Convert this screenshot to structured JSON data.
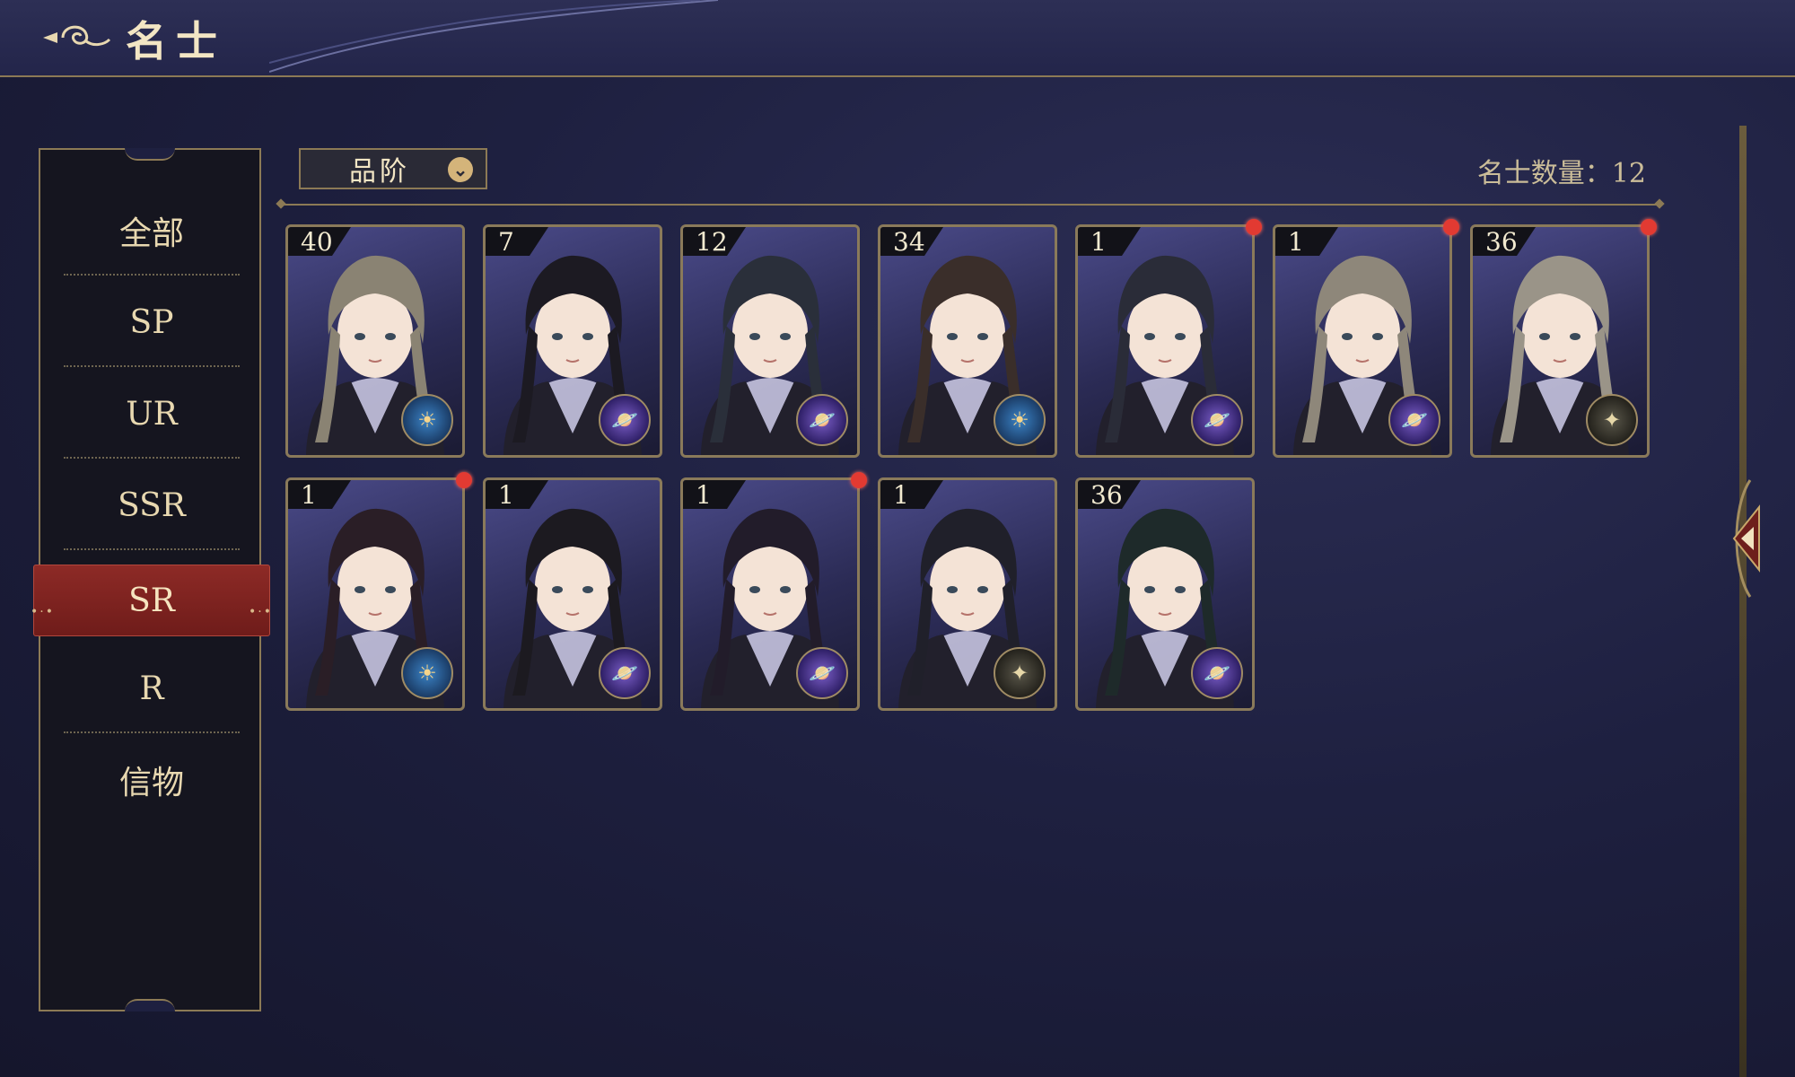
{
  "header": {
    "title": "名士"
  },
  "sidebar": {
    "items": [
      {
        "label": "全部"
      },
      {
        "label": "SP"
      },
      {
        "label": "UR"
      },
      {
        "label": "SSR"
      },
      {
        "label": "SR"
      },
      {
        "label": "R"
      },
      {
        "label": "信物"
      }
    ],
    "active_index": 4
  },
  "filter": {
    "label": "品阶"
  },
  "count_text": "名士数量：12",
  "cards": [
    {
      "level": "40",
      "badge": "blue",
      "new": false,
      "icon": "sun-emblem-icon"
    },
    {
      "level": "7",
      "badge": "purple",
      "new": false,
      "icon": "planet-emblem-icon"
    },
    {
      "level": "12",
      "badge": "purple",
      "new": false,
      "icon": "planet-emblem-icon"
    },
    {
      "level": "34",
      "badge": "blue",
      "new": false,
      "icon": "sun-emblem-icon"
    },
    {
      "level": "1",
      "badge": "purple",
      "new": true,
      "icon": "planet-emblem-icon"
    },
    {
      "level": "1",
      "badge": "purple",
      "new": true,
      "icon": "planet-emblem-icon"
    },
    {
      "level": "36",
      "badge": "dark",
      "new": true,
      "icon": "star-emblem-icon"
    },
    {
      "level": "1",
      "badge": "blue",
      "new": true,
      "icon": "sun-emblem-icon"
    },
    {
      "level": "1",
      "badge": "purple",
      "new": false,
      "icon": "planet-emblem-icon"
    },
    {
      "level": "1",
      "badge": "purple",
      "new": true,
      "icon": "planet-emblem-icon"
    },
    {
      "level": "1",
      "badge": "dark",
      "new": false,
      "icon": "star-emblem-icon"
    },
    {
      "level": "36",
      "badge": "purple",
      "new": false,
      "icon": "planet-emblem-icon"
    }
  ],
  "colors": {
    "gold": "#8c7a55",
    "active": "#8d2a26",
    "notify": "#e23a32"
  }
}
